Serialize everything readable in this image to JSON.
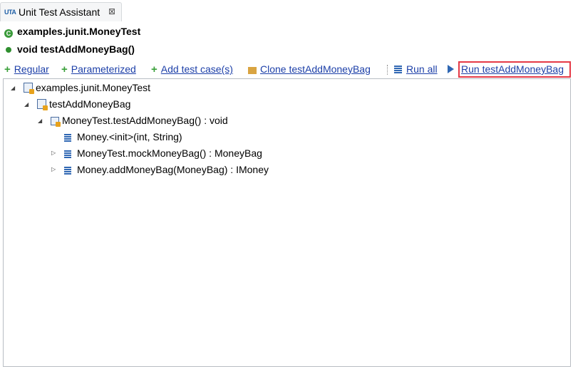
{
  "tab": {
    "icon_text": "UTA",
    "title": "Unit Test Assistant",
    "close_glyph": "⊠"
  },
  "header": {
    "class_name": "examples.junit.MoneyTest",
    "method_name": "void testAddMoneyBag()"
  },
  "toolbar": {
    "regular": "Regular",
    "parameterized": "Parameterized",
    "add_test_case": "Add test case(s)",
    "clone": "Clone testAddMoneyBag",
    "run_all": "Run all",
    "run_one": "Run testAddMoneyBag"
  },
  "tree": [
    {
      "label": "examples.junit.MoneyTest",
      "level": 0,
      "expanded": true,
      "icon": "test-class-icon"
    },
    {
      "label": "testAddMoneyBag",
      "level": 1,
      "expanded": true,
      "icon": "test-method-icon"
    },
    {
      "label": "MoneyTest.testAddMoneyBag() : void",
      "level": 2,
      "expanded": true,
      "icon": "call-icon"
    },
    {
      "label": "Money.<init>(int, String)",
      "level": 3,
      "expanded": null,
      "icon": "list-icon"
    },
    {
      "label": "MoneyTest.mockMoneyBag() : MoneyBag",
      "level": 3,
      "expanded": false,
      "icon": "list-icon"
    },
    {
      "label": "Money.addMoneyBag(MoneyBag) : IMoney",
      "level": 3,
      "expanded": false,
      "icon": "list-icon"
    }
  ],
  "colors": {
    "link": "#1c3fa8",
    "highlight": "#e53946",
    "add_green": "#3aa03a"
  }
}
